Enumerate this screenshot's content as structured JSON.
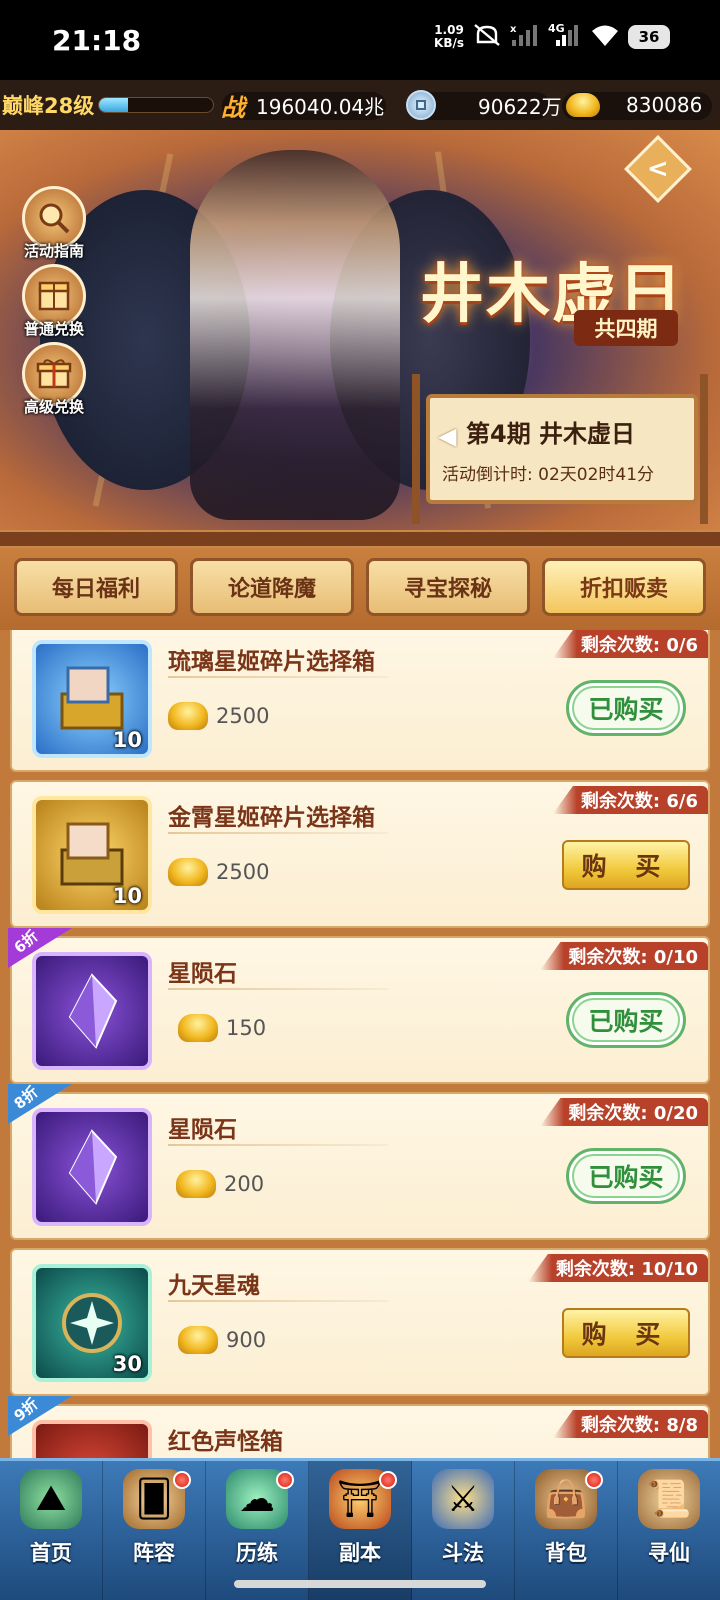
{
  "status_bar": {
    "time": "21:18",
    "net_speed_value": "1.09",
    "net_speed_unit": "KB/s",
    "network_type": "4G",
    "battery": "36"
  },
  "resources": {
    "level": "巅峰28级",
    "level_progress": 0.25,
    "combat_icon": "战",
    "combat_power": "196040.04兆",
    "coins": "90622万",
    "ingots": "830086"
  },
  "side_buttons": [
    {
      "label": "活动指南",
      "icon": "search-icon"
    },
    {
      "label": "普通兑换",
      "icon": "chest-icon"
    },
    {
      "label": "高级兑换",
      "icon": "gift-icon"
    }
  ],
  "event": {
    "title": "井木虚日",
    "subtitle": "共四期",
    "period_title": "第4期  井木虚日",
    "countdown": "活动倒计时: 02天02时41分"
  },
  "tabs": [
    {
      "label": "每日福利",
      "active": false
    },
    {
      "label": "论道降魔",
      "active": false
    },
    {
      "label": "寻宝探秘",
      "active": false
    },
    {
      "label": "折扣贩卖",
      "active": true
    }
  ],
  "items": [
    {
      "name": "琉璃星姬碎片选择箱",
      "price": "2500",
      "remaining": "剩余次数: 0/6",
      "button": "已购买",
      "status": "bought",
      "count": "10",
      "icon": "blue-chest-icon",
      "discount": ""
    },
    {
      "name": "金霄星姬碎片选择箱",
      "price": "2500",
      "remaining": "剩余次数: 6/6",
      "button": "购 买",
      "status": "buy",
      "count": "10",
      "icon": "gold-chest-icon",
      "discount": ""
    },
    {
      "name": "星陨石",
      "price": "150",
      "remaining": "剩余次数: 0/10",
      "button": "已购买",
      "status": "bought",
      "count": "",
      "icon": "purple-crystal-icon",
      "discount": "6折"
    },
    {
      "name": "星陨石",
      "price": "200",
      "remaining": "剩余次数: 0/20",
      "button": "已购买",
      "status": "bought",
      "count": "",
      "icon": "purple-crystal-icon",
      "discount": "8折"
    },
    {
      "name": "九天星魂",
      "price": "900",
      "remaining": "剩余次数: 10/10",
      "button": "购 买",
      "status": "buy",
      "count": "30",
      "icon": "star-orb-icon",
      "discount": ""
    },
    {
      "name": "红色声怪箱",
      "price": "",
      "remaining": "剩余次数: 8/8",
      "button": "",
      "status": "partial",
      "count": "",
      "icon": "red-box-icon",
      "discount": "9折"
    }
  ],
  "bottom_nav": [
    {
      "label": "首页",
      "dot": false
    },
    {
      "label": "阵容",
      "dot": true
    },
    {
      "label": "历练",
      "dot": true
    },
    {
      "label": "副本",
      "dot": true
    },
    {
      "label": "斗法",
      "dot": false
    },
    {
      "label": "背包",
      "dot": true
    },
    {
      "label": "寻仙",
      "dot": false
    }
  ],
  "colors": {
    "accent": "#b8412a",
    "tab_bg": "#c97f3e",
    "bought_green": "#2f8f3a",
    "buy_gold": "#f2c93c"
  }
}
